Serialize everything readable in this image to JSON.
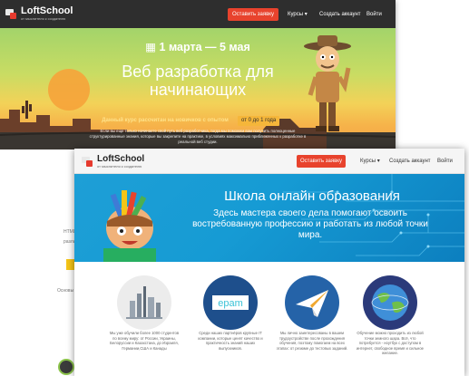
{
  "back": {
    "logo": {
      "name": "LoftSchool",
      "tagline": "от мыслителя к создателю"
    },
    "nav": {
      "cta": "Оставить заявку",
      "courses": "Курсы",
      "create_account": "Создать аккаунт",
      "login": "Войти"
    },
    "hero": {
      "date": "1 марта — 5 мая",
      "title": "Веб разработка для начинающих",
      "note": "Данный курс рассчитан на новичков с опытом",
      "badge": "от 0 до 1 года",
      "description": "Если вы еще только начинаете свой путь веб разработчика, тогда мы поможем вам получить полноценные структурированные знания, которые вы закрепите на практике, в условиях максимально приближенных к разработке в реальной веб студии."
    },
    "fragments": {
      "html": "HTML5 и",
      "razl": "разли",
      "osnovy": "Основы"
    }
  },
  "front": {
    "logo": {
      "name": "LoftSchool",
      "tagline": "от мыслителя к создателю"
    },
    "nav": {
      "cta": "Оставить заявку",
      "courses": "Курсы",
      "create_account": "Создать аккаунт",
      "login": "Войти"
    },
    "hero": {
      "title": "Школа онлайн образования",
      "subtitle": "Здесь мастера своего дела помогают освоить востребованную профессию и работать из любой точки мира."
    },
    "features": [
      {
        "icon": "students-city-icon",
        "color": "#e4e4e4",
        "text": "Мы уже обучили более 1000 студентов по всему миру: от России, Украины, Белоруссии и Казахстана, до Израиля, Германии,США и Канады"
      },
      {
        "icon": "epam-logo-icon",
        "color": "#1e4f8c",
        "logo_text": "epam",
        "text": "Среди наших партнёров крупные IT компании, которые ценят качество и практичность знаний наших выпускников."
      },
      {
        "icon": "paper-plane-icon",
        "color": "#2563a8",
        "text": "Мы лично заинтересованы в вашем трудоустройстве после прохождения обучения, поэтому помогаем на всех этапах: от резюме до тестовых заданий."
      },
      {
        "icon": "globe-icon",
        "color": "#2b3a7a",
        "text": "Обучение можно проходить из любой точки земного шара. Всё, что потребуется - ноутбук с доступом в интернет, свободное время и сильное желание."
      }
    ]
  }
}
